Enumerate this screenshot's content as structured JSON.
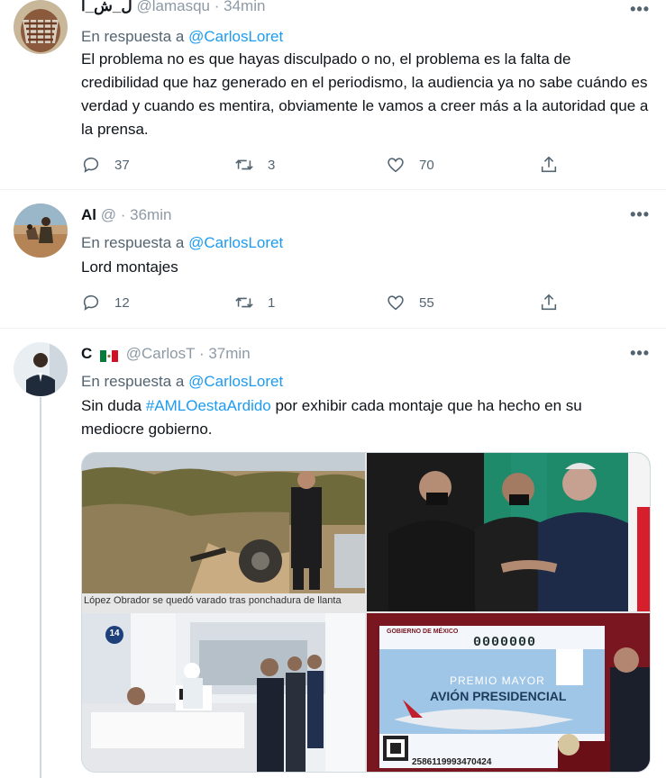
{
  "tweets": [
    {
      "name": "ل_ش_أ",
      "handle": "@lamasqu",
      "time": "34min",
      "reply_label": "En respuesta a",
      "reply_mention": "@CarlosLoret",
      "text": "El problema no es que hayas disculpado o no, el problema es la falta de credibilidad que haz generado en el periodismo, la audiencia ya no sabe cuándo es verdad y cuando es mentira, obviamente le vamos a creer más a la autoridad que a la prensa.",
      "replies": "37",
      "retweets": "3",
      "likes": "70"
    },
    {
      "name": "Al",
      "handle": "@",
      "time": "36min",
      "reply_label": "En respuesta a",
      "reply_mention": "@CarlosLoret",
      "text": "Lord montajes",
      "replies": "12",
      "retweets": "1",
      "likes": "55"
    },
    {
      "name": "C",
      "handle": "@CarlosT",
      "time": "37min",
      "reply_label": "En respuesta a",
      "reply_mention": "@CarlosLoret",
      "text_before": "Sin duda ",
      "hashtag": "#AMLOestaArdido",
      "text_after": " por exhibir cada montaje que ha hecho en su mediocre gobierno.",
      "media_caption": "López Obrador se quedó varado tras ponchadura de llanta",
      "ticket": {
        "header": "GOBIERNO DE MÉXICO",
        "number": "0000000",
        "premio": "PREMIO MAYOR",
        "title": "AVIÓN PRESIDENCIAL",
        "serial": "2586119993470424"
      },
      "room_number": "14"
    }
  ],
  "more_icon": "•••",
  "colors": {
    "link": "#1d9bf0",
    "muted": "#536471"
  }
}
